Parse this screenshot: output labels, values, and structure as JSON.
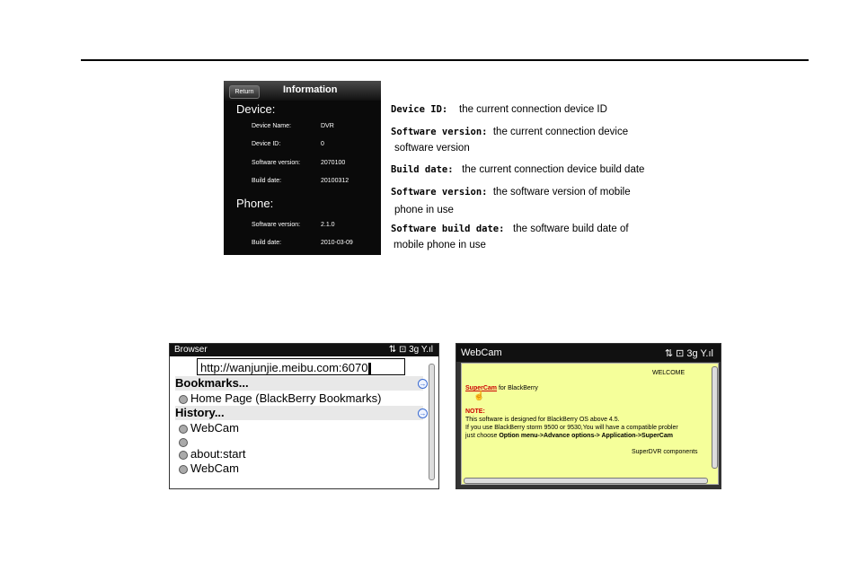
{
  "info_screen": {
    "return_label": "Return",
    "title": "Information",
    "device_heading": "Device:",
    "device_rows": [
      {
        "label": "Device Name:",
        "value": "DVR"
      },
      {
        "label": "Device ID:",
        "value": "0"
      },
      {
        "label": "Software version:",
        "value": "2070100"
      },
      {
        "label": "Build date:",
        "value": "20100312"
      }
    ],
    "phone_heading": "Phone:",
    "phone_rows": [
      {
        "label": "Software version:",
        "value": "2.1.0"
      },
      {
        "label": "Build date:",
        "value": "2010-03-09"
      }
    ]
  },
  "descriptions": [
    {
      "term": "Device ID:",
      "text": "the current connection device ID",
      "cont": ""
    },
    {
      "term": "Software version:",
      "text": "the current connection device",
      "cont": "software version"
    },
    {
      "term": "Build date:",
      "text": "the current connection device build date",
      "cont": ""
    },
    {
      "term": "Software version:",
      "text": "the  software version of mobile",
      "cont": "phone in use"
    },
    {
      "term": "Software build date:",
      "text": "the software build date of",
      "cont": "mobile  phone in use"
    }
  ],
  "browser": {
    "title": "Browser",
    "status_icons": "⇅ ⊡  3g  Y.ıl",
    "url": "http://wanjunjie.meibu.com:6070",
    "bookmarks_heading": "Bookmarks...",
    "bookmarks": [
      "Home Page (BlackBerry Bookmarks)"
    ],
    "history_heading": "History...",
    "history": [
      "WebCam",
      "",
      "about:start",
      "WebCam"
    ]
  },
  "webcam": {
    "title": "WebCam",
    "status_icons": "⇅ ⊡  3g  Y.ıl",
    "welcome": "WELCOME",
    "link": "SuperCam",
    "link_suffix": " for BlackBerry",
    "note_label": "NOTE:",
    "note_line1": "This software is designed for BlackBerry OS above 4.5.",
    "note_line2": "If you use BlackBerry storm 9500 or 9530,You will have a compatible probler",
    "note_line3_prefix": "just choose ",
    "note_line3_bold": "Option menu->Advance options-> Application->SuperCam",
    "footer": "SuperDVR components"
  }
}
